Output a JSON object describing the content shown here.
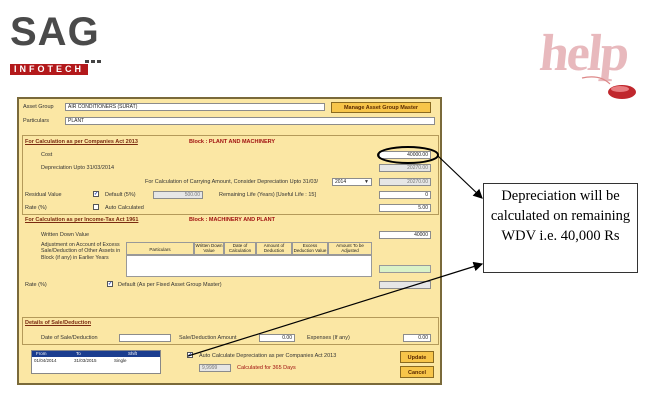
{
  "logo": {
    "main": "SAG",
    "sub": "INFOTECH"
  },
  "help": {
    "text": "help"
  },
  "form": {
    "asset_group_label": "Asset Group",
    "asset_group_value": "AIR CONDITIONERS (SURAT)",
    "manage_button": "Manage Asset Group Master",
    "particulars_label": "Particulars",
    "particulars_value": "PLANT",
    "companies_act": {
      "heading": "For Calculation as per Companies Act 2013",
      "block": "Block : PLANT AND MACHINERY",
      "cost_label": "Cost",
      "cost_value": "40000.00",
      "depr_upto_label": "Depreciation Upto 31/03/2014",
      "depr_upto_value": "20270.00",
      "carrying_label": "For Calculation of Carrying Amount, Consider Depreciation Upto 31/03/",
      "carrying_year": "2014",
      "carrying_value": "20270.00",
      "residual_label": "Residual Value",
      "default_label": "Default (5%)",
      "residual_value": "500.00",
      "remaining_life_label": "Remaining Life (Years) [Useful Life : 15]",
      "remaining_life_value": "0",
      "rate_label": "Rate (%)",
      "auto_calc_label": "Auto Calculated",
      "rate_value": "5.00"
    },
    "income_tax": {
      "heading": "For Calculation as per Income-Tax Act 1961",
      "block": "Block : MACHINERY AND PLANT",
      "wdv_label": "Written Down Value",
      "wdv_value": "40000",
      "adjustment_label": "Adjustment on Account of Excess Sale/Deduction of Other Assets in Block (if any) in Earlier Years",
      "table_headers": [
        "Particulars",
        "Written Down Value",
        "Date of Calculation",
        "Amount of Deduction",
        "Excess Deduction Value",
        "Amount To be Adjusted"
      ],
      "rate_label": "Rate (%)",
      "rate_default_label": "Default (As per Fixed Asset Group Master)"
    },
    "sale": {
      "heading": "Details of Sale/Deduction",
      "date_label": "Date of Sale/Deduction",
      "amount_label": "Sale/Deduction Amount",
      "amount_value": "0.00",
      "expenses_label": "Expenses (If any)",
      "expenses_value": "0.00"
    },
    "period": {
      "headers": [
        "From",
        "To",
        "Shift"
      ],
      "row": [
        "01/04/2014",
        "31/03/2015",
        "Single"
      ]
    },
    "auto_depr_label": "Auto Calculate Depreciation as per Companies Act 2013",
    "days_value": "9,9999",
    "days_label": "Calculated for 365 Days",
    "update_button": "Update",
    "cancel_button": "Cancel"
  },
  "callout": {
    "text": "Depreciation will be calculated on remaining WDV i.e. 40,000 Rs"
  }
}
